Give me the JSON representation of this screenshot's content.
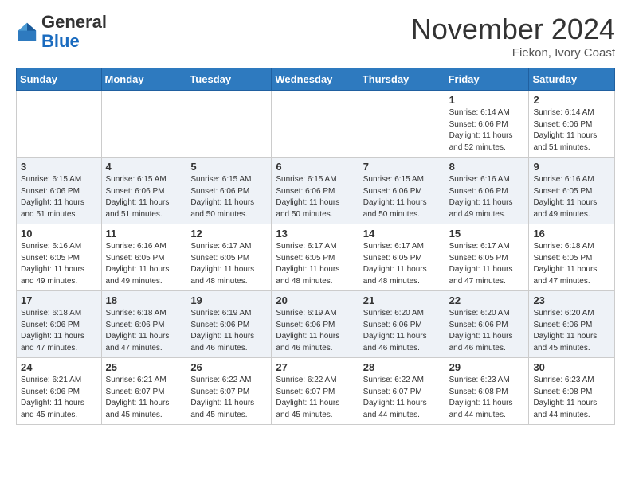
{
  "header": {
    "logo_general": "General",
    "logo_blue": "Blue",
    "month_title": "November 2024",
    "location": "Fiekon, Ivory Coast"
  },
  "weekdays": [
    "Sunday",
    "Monday",
    "Tuesday",
    "Wednesday",
    "Thursday",
    "Friday",
    "Saturday"
  ],
  "weeks": [
    [
      {
        "day": "",
        "info": ""
      },
      {
        "day": "",
        "info": ""
      },
      {
        "day": "",
        "info": ""
      },
      {
        "day": "",
        "info": ""
      },
      {
        "day": "",
        "info": ""
      },
      {
        "day": "1",
        "info": "Sunrise: 6:14 AM\nSunset: 6:06 PM\nDaylight: 11 hours\nand 52 minutes."
      },
      {
        "day": "2",
        "info": "Sunrise: 6:14 AM\nSunset: 6:06 PM\nDaylight: 11 hours\nand 51 minutes."
      }
    ],
    [
      {
        "day": "3",
        "info": "Sunrise: 6:15 AM\nSunset: 6:06 PM\nDaylight: 11 hours\nand 51 minutes."
      },
      {
        "day": "4",
        "info": "Sunrise: 6:15 AM\nSunset: 6:06 PM\nDaylight: 11 hours\nand 51 minutes."
      },
      {
        "day": "5",
        "info": "Sunrise: 6:15 AM\nSunset: 6:06 PM\nDaylight: 11 hours\nand 50 minutes."
      },
      {
        "day": "6",
        "info": "Sunrise: 6:15 AM\nSunset: 6:06 PM\nDaylight: 11 hours\nand 50 minutes."
      },
      {
        "day": "7",
        "info": "Sunrise: 6:15 AM\nSunset: 6:06 PM\nDaylight: 11 hours\nand 50 minutes."
      },
      {
        "day": "8",
        "info": "Sunrise: 6:16 AM\nSunset: 6:06 PM\nDaylight: 11 hours\nand 49 minutes."
      },
      {
        "day": "9",
        "info": "Sunrise: 6:16 AM\nSunset: 6:05 PM\nDaylight: 11 hours\nand 49 minutes."
      }
    ],
    [
      {
        "day": "10",
        "info": "Sunrise: 6:16 AM\nSunset: 6:05 PM\nDaylight: 11 hours\nand 49 minutes."
      },
      {
        "day": "11",
        "info": "Sunrise: 6:16 AM\nSunset: 6:05 PM\nDaylight: 11 hours\nand 49 minutes."
      },
      {
        "day": "12",
        "info": "Sunrise: 6:17 AM\nSunset: 6:05 PM\nDaylight: 11 hours\nand 48 minutes."
      },
      {
        "day": "13",
        "info": "Sunrise: 6:17 AM\nSunset: 6:05 PM\nDaylight: 11 hours\nand 48 minutes."
      },
      {
        "day": "14",
        "info": "Sunrise: 6:17 AM\nSunset: 6:05 PM\nDaylight: 11 hours\nand 48 minutes."
      },
      {
        "day": "15",
        "info": "Sunrise: 6:17 AM\nSunset: 6:05 PM\nDaylight: 11 hours\nand 47 minutes."
      },
      {
        "day": "16",
        "info": "Sunrise: 6:18 AM\nSunset: 6:05 PM\nDaylight: 11 hours\nand 47 minutes."
      }
    ],
    [
      {
        "day": "17",
        "info": "Sunrise: 6:18 AM\nSunset: 6:06 PM\nDaylight: 11 hours\nand 47 minutes."
      },
      {
        "day": "18",
        "info": "Sunrise: 6:18 AM\nSunset: 6:06 PM\nDaylight: 11 hours\nand 47 minutes."
      },
      {
        "day": "19",
        "info": "Sunrise: 6:19 AM\nSunset: 6:06 PM\nDaylight: 11 hours\nand 46 minutes."
      },
      {
        "day": "20",
        "info": "Sunrise: 6:19 AM\nSunset: 6:06 PM\nDaylight: 11 hours\nand 46 minutes."
      },
      {
        "day": "21",
        "info": "Sunrise: 6:20 AM\nSunset: 6:06 PM\nDaylight: 11 hours\nand 46 minutes."
      },
      {
        "day": "22",
        "info": "Sunrise: 6:20 AM\nSunset: 6:06 PM\nDaylight: 11 hours\nand 46 minutes."
      },
      {
        "day": "23",
        "info": "Sunrise: 6:20 AM\nSunset: 6:06 PM\nDaylight: 11 hours\nand 45 minutes."
      }
    ],
    [
      {
        "day": "24",
        "info": "Sunrise: 6:21 AM\nSunset: 6:06 PM\nDaylight: 11 hours\nand 45 minutes."
      },
      {
        "day": "25",
        "info": "Sunrise: 6:21 AM\nSunset: 6:07 PM\nDaylight: 11 hours\nand 45 minutes."
      },
      {
        "day": "26",
        "info": "Sunrise: 6:22 AM\nSunset: 6:07 PM\nDaylight: 11 hours\nand 45 minutes."
      },
      {
        "day": "27",
        "info": "Sunrise: 6:22 AM\nSunset: 6:07 PM\nDaylight: 11 hours\nand 45 minutes."
      },
      {
        "day": "28",
        "info": "Sunrise: 6:22 AM\nSunset: 6:07 PM\nDaylight: 11 hours\nand 44 minutes."
      },
      {
        "day": "29",
        "info": "Sunrise: 6:23 AM\nSunset: 6:08 PM\nDaylight: 11 hours\nand 44 minutes."
      },
      {
        "day": "30",
        "info": "Sunrise: 6:23 AM\nSunset: 6:08 PM\nDaylight: 11 hours\nand 44 minutes."
      }
    ]
  ]
}
